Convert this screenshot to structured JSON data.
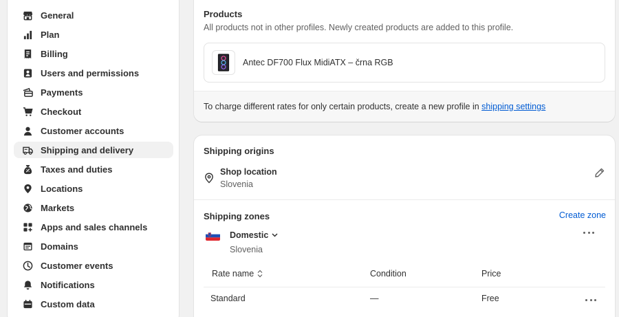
{
  "sidebar": {
    "items": [
      {
        "label": "General",
        "icon": "store-icon"
      },
      {
        "label": "Plan",
        "icon": "chart-icon"
      },
      {
        "label": "Billing",
        "icon": "receipt-icon"
      },
      {
        "label": "Users and permissions",
        "icon": "person-icon"
      },
      {
        "label": "Payments",
        "icon": "credit-card-icon"
      },
      {
        "label": "Checkout",
        "icon": "cart-icon"
      },
      {
        "label": "Customer accounts",
        "icon": "user-icon"
      },
      {
        "label": "Shipping and delivery",
        "icon": "truck-icon",
        "active": true
      },
      {
        "label": "Taxes and duties",
        "icon": "tax-bag-icon"
      },
      {
        "label": "Locations",
        "icon": "location-pin-icon"
      },
      {
        "label": "Markets",
        "icon": "globe-icon"
      },
      {
        "label": "Apps and sales channels",
        "icon": "apps-icon"
      },
      {
        "label": "Domains",
        "icon": "domain-icon"
      },
      {
        "label": "Customer events",
        "icon": "events-icon"
      },
      {
        "label": "Notifications",
        "icon": "bell-icon"
      },
      {
        "label": "Custom data",
        "icon": "database-icon"
      }
    ]
  },
  "products": {
    "title": "Products",
    "subtitle": "All products not in other profiles. Newly created products are added to this profile.",
    "product_name": "Antec DF700 Flux MidiATX – črna RGB",
    "footer_text": "To charge different rates for only certain products, create a new profile in",
    "footer_link": "shipping settings"
  },
  "shipping": {
    "origins_title": "Shipping origins",
    "location_name": "Shop location",
    "location_country": "Slovenia",
    "zones_title": "Shipping zones",
    "create_zone": "Create zone",
    "zone_name": "Domestic",
    "zone_country": "Slovenia",
    "table": {
      "headers": [
        "Rate name",
        "Condition",
        "Price"
      ],
      "rows": [
        {
          "rate": "Standard",
          "condition": "—",
          "price": "Free"
        }
      ]
    }
  },
  "colors": {
    "accent": "#005bd3",
    "background": "#f1f1f1"
  }
}
